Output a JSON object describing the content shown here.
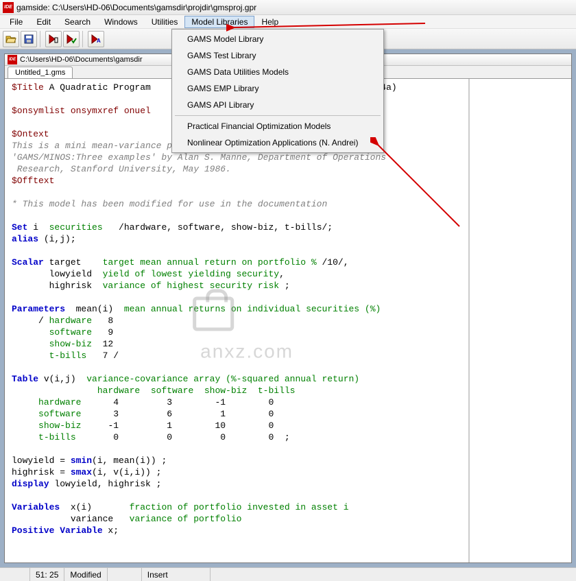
{
  "title": "gamside: C:\\Users\\HD-06\\Documents\\gamsdir\\projdir\\gmsproj.gpr",
  "menu": {
    "file": "File",
    "edit": "Edit",
    "search": "Search",
    "windows": "Windows",
    "utilities": "Utilities",
    "model_libraries": "Model Libraries",
    "help": "Help"
  },
  "dropdown": {
    "items": [
      "GAMS Model Library",
      "GAMS Test Library",
      "GAMS Data Utilities Models",
      "GAMS EMP Library",
      "GAMS API Library"
    ],
    "items2": [
      "Practical Financial Optimization Models",
      "Nonlinear Optimization Applications (N. Andrei)"
    ]
  },
  "child_title": "C:\\Users\\HD-06\\Documents\\gamsdir",
  "tab": "Untitled_1.gms",
  "code_tail": "4a)",
  "status": {
    "pos": "51: 25",
    "modified": "Modified",
    "insert": "Insert"
  },
  "watermark": "anxz.com"
}
